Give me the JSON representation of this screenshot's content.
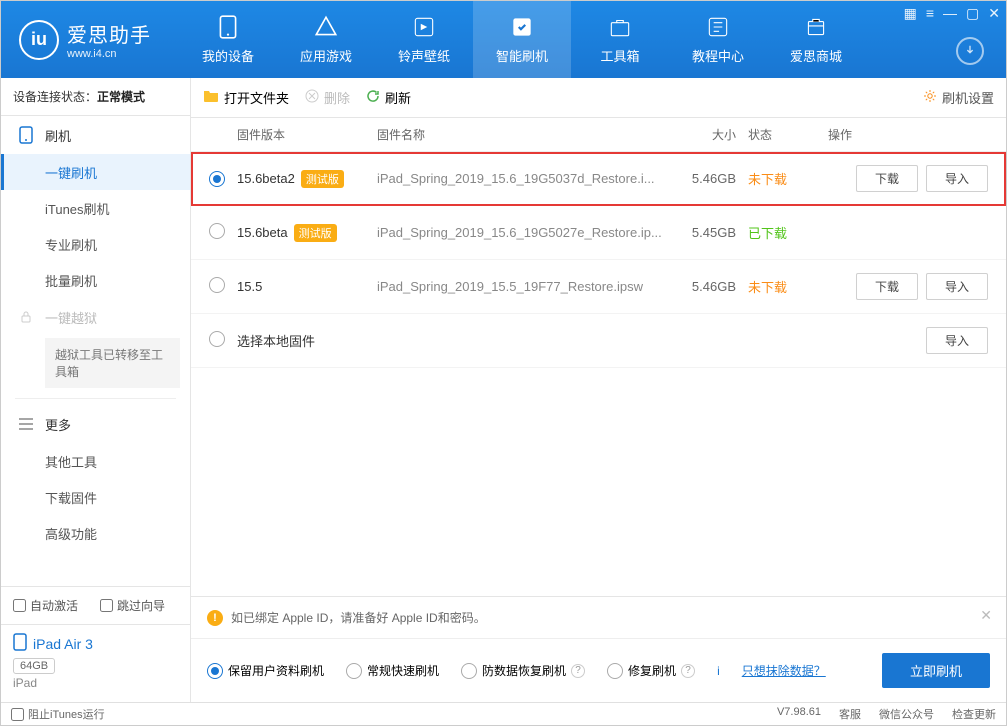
{
  "logo": {
    "icon_text": "iu",
    "title": "爱思助手",
    "url": "www.i4.cn"
  },
  "nav": [
    {
      "label": "我的设备"
    },
    {
      "label": "应用游戏"
    },
    {
      "label": "铃声壁纸"
    },
    {
      "label": "智能刷机"
    },
    {
      "label": "工具箱"
    },
    {
      "label": "教程中心"
    },
    {
      "label": "爱思商城"
    }
  ],
  "sidebar": {
    "conn_label": "设备连接状态：",
    "conn_value": "正常模式",
    "flash_heading": "刷机",
    "flash_items": [
      "一键刷机",
      "iTunes刷机",
      "专业刷机",
      "批量刷机"
    ],
    "jailbreak_heading": "一键越狱",
    "jailbreak_note": "越狱工具已转移至工具箱",
    "more_heading": "更多",
    "more_items": [
      "其他工具",
      "下载固件",
      "高级功能"
    ],
    "auto": {
      "activate": "自动激活",
      "skip": "跳过向导"
    },
    "device": {
      "name": "iPad Air 3",
      "storage": "64GB",
      "type": "iPad"
    }
  },
  "toolbar": {
    "open": "打开文件夹",
    "delete": "删除",
    "refresh": "刷新",
    "settings": "刷机设置"
  },
  "table": {
    "head": {
      "version": "固件版本",
      "name": "固件名称",
      "size": "大小",
      "status": "状态",
      "ops": "操作"
    },
    "btn_download": "下载",
    "btn_import": "导入",
    "rows": [
      {
        "selected": true,
        "highlighted": true,
        "version": "15.6beta2",
        "beta": "测试版",
        "name": "iPad_Spring_2019_15.6_19G5037d_Restore.i...",
        "size": "5.46GB",
        "status": "未下载",
        "status_cls": "orange",
        "show_ops": true
      },
      {
        "selected": false,
        "version": "15.6beta",
        "beta": "测试版",
        "name": "iPad_Spring_2019_15.6_19G5027e_Restore.ip...",
        "size": "5.45GB",
        "status": "已下载",
        "status_cls": "green",
        "show_ops": false
      },
      {
        "selected": false,
        "version": "15.5",
        "beta": "",
        "name": "iPad_Spring_2019_15.5_19F77_Restore.ipsw",
        "size": "5.46GB",
        "status": "未下载",
        "status_cls": "orange",
        "show_ops": true
      },
      {
        "selected": false,
        "version": "选择本地固件",
        "beta": "",
        "name": "",
        "size": "",
        "status": "",
        "status_cls": "",
        "local": true
      }
    ]
  },
  "notice": "如已绑定 Apple ID，请准备好 Apple ID和密码。",
  "options": {
    "opt1": "保留用户资料刷机",
    "opt2": "常规快速刷机",
    "opt3": "防数据恢复刷机",
    "opt4": "修复刷机",
    "erase_link": "只想抹除数据？",
    "primary": "立即刷机"
  },
  "statusbar": {
    "block_itunes": "阻止iTunes运行",
    "version": "V7.98.61",
    "items": [
      "客服",
      "微信公众号",
      "检查更新"
    ]
  }
}
